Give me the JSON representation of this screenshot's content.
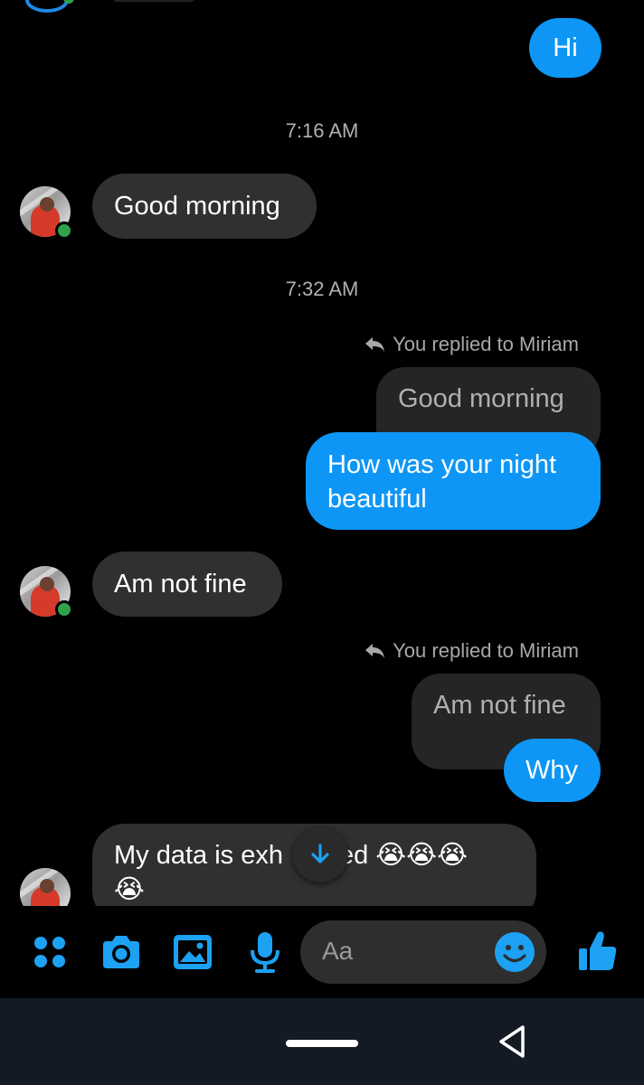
{
  "colors": {
    "outgoing_bubble": "#0d96f5",
    "incoming_bubble": "#303030",
    "quoted_bubble": "#252525",
    "accent_icon": "#1da1f2",
    "online_status": "#31a24c",
    "navbar": "#131a24"
  },
  "conversation": {
    "msg_hi": "Hi",
    "time_1": "7:16 AM",
    "msg_good_morning": "Good morning",
    "time_2": "7:32 AM",
    "reply_note_1": "You replied to Miriam",
    "quoted_1": "Good morning",
    "msg_how_was_night": "How was your night beautiful",
    "msg_am_not_fine": "Am not fine",
    "reply_note_2": "You replied to Miriam",
    "quoted_2": "Am not fine",
    "msg_why": "Why",
    "msg_data_a": "My data is exh",
    "msg_data_b": "ed 😭😭😭",
    "msg_data_c": "😭"
  },
  "composer": {
    "placeholder": "Aa",
    "icons": [
      "apps-icon",
      "camera-icon",
      "gallery-icon",
      "microphone-icon",
      "emoji-icon",
      "thumbs-up-icon"
    ]
  },
  "nav": {
    "icons": [
      "home-pill",
      "back-icon"
    ]
  }
}
